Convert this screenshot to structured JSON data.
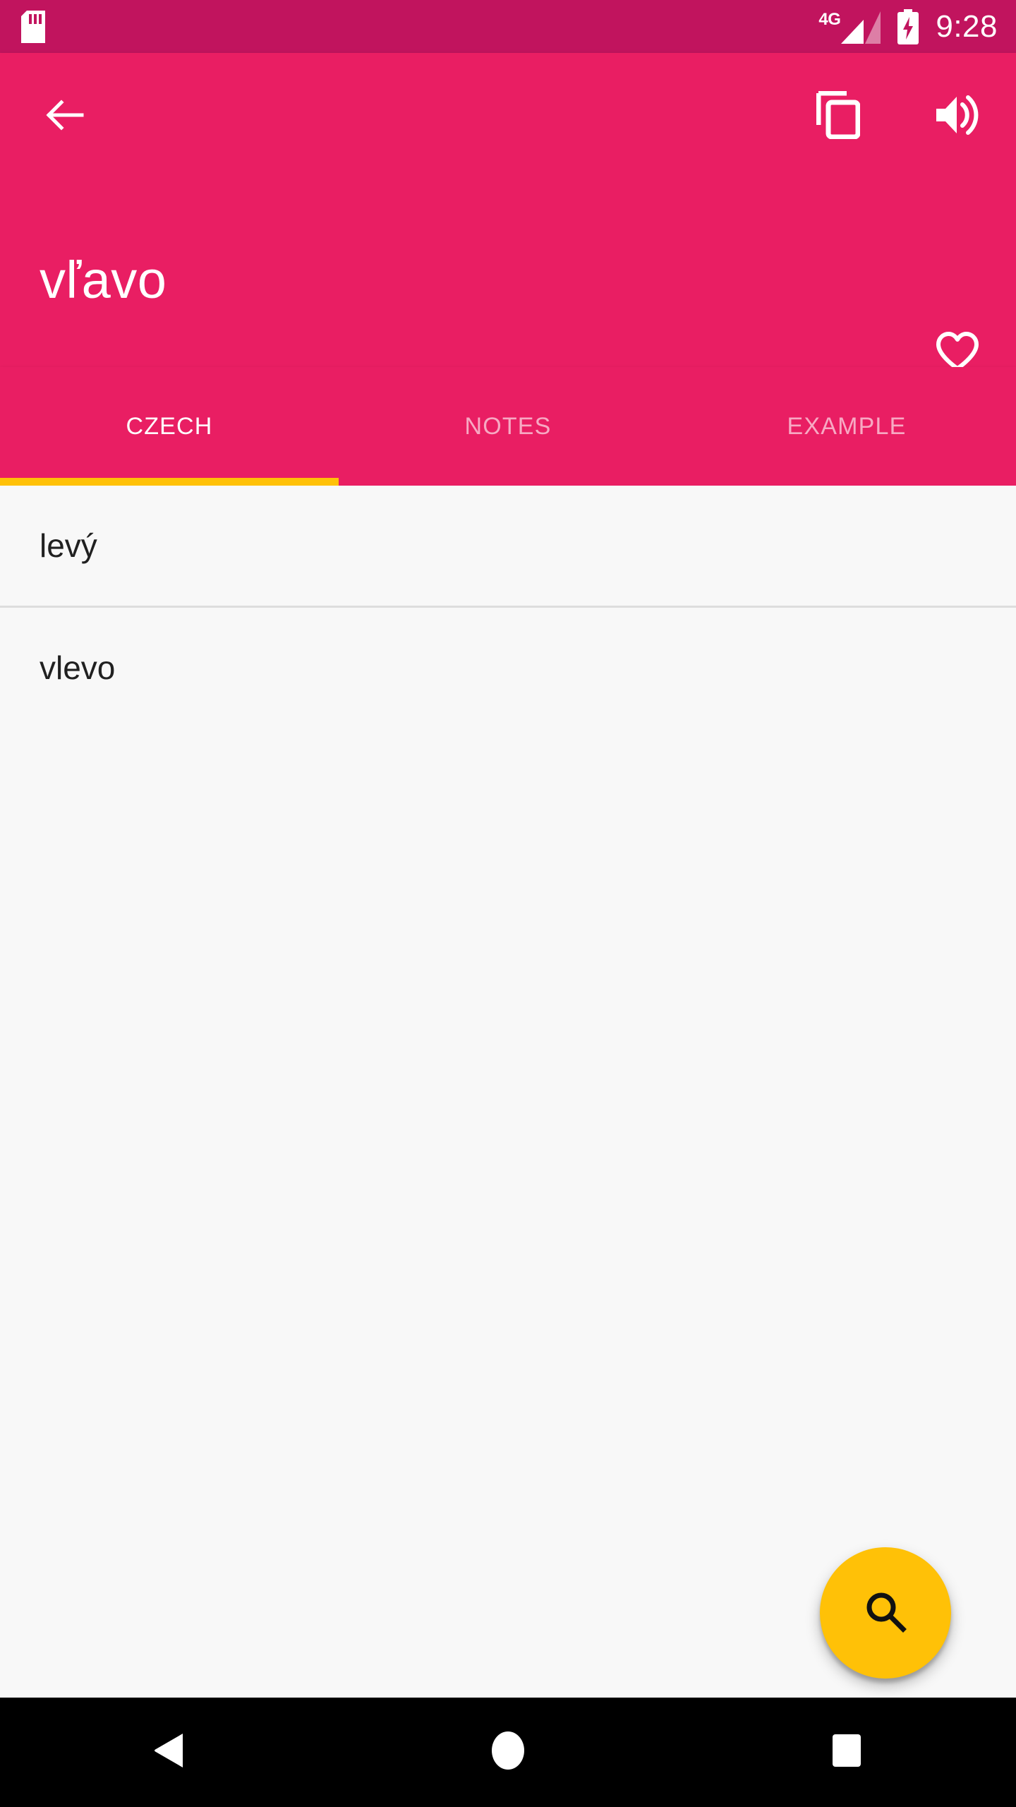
{
  "status_bar": {
    "sd_card_icon": "sd-card-icon",
    "network_type": "4G",
    "signal_icon": "signal-bars-icon",
    "battery_icon": "battery-charging-icon",
    "time": "9:28",
    "background_color": "#C1145E"
  },
  "app_bar": {
    "back_icon": "back-arrow-icon",
    "copy_icon": "copy-icon",
    "speaker_icon": "volume-up-icon",
    "headword": "vľavo",
    "favorite_icon": "heart-outline-icon",
    "background_color": "#E91E63"
  },
  "tabs": {
    "items": [
      {
        "label": "CZECH",
        "active": true
      },
      {
        "label": "NOTES",
        "active": false
      },
      {
        "label": "EXAMPLE",
        "active": false
      }
    ],
    "indicator_color": "#FFC107"
  },
  "translations": {
    "items": [
      {
        "text": "levý"
      },
      {
        "text": "vlevo"
      }
    ]
  },
  "fab": {
    "icon": "search-icon",
    "background_color": "#FFC107"
  },
  "nav_bar": {
    "back_icon": "nav-back-triangle-icon",
    "home_icon": "nav-home-circle-icon",
    "recents_icon": "nav-recents-square-icon"
  }
}
